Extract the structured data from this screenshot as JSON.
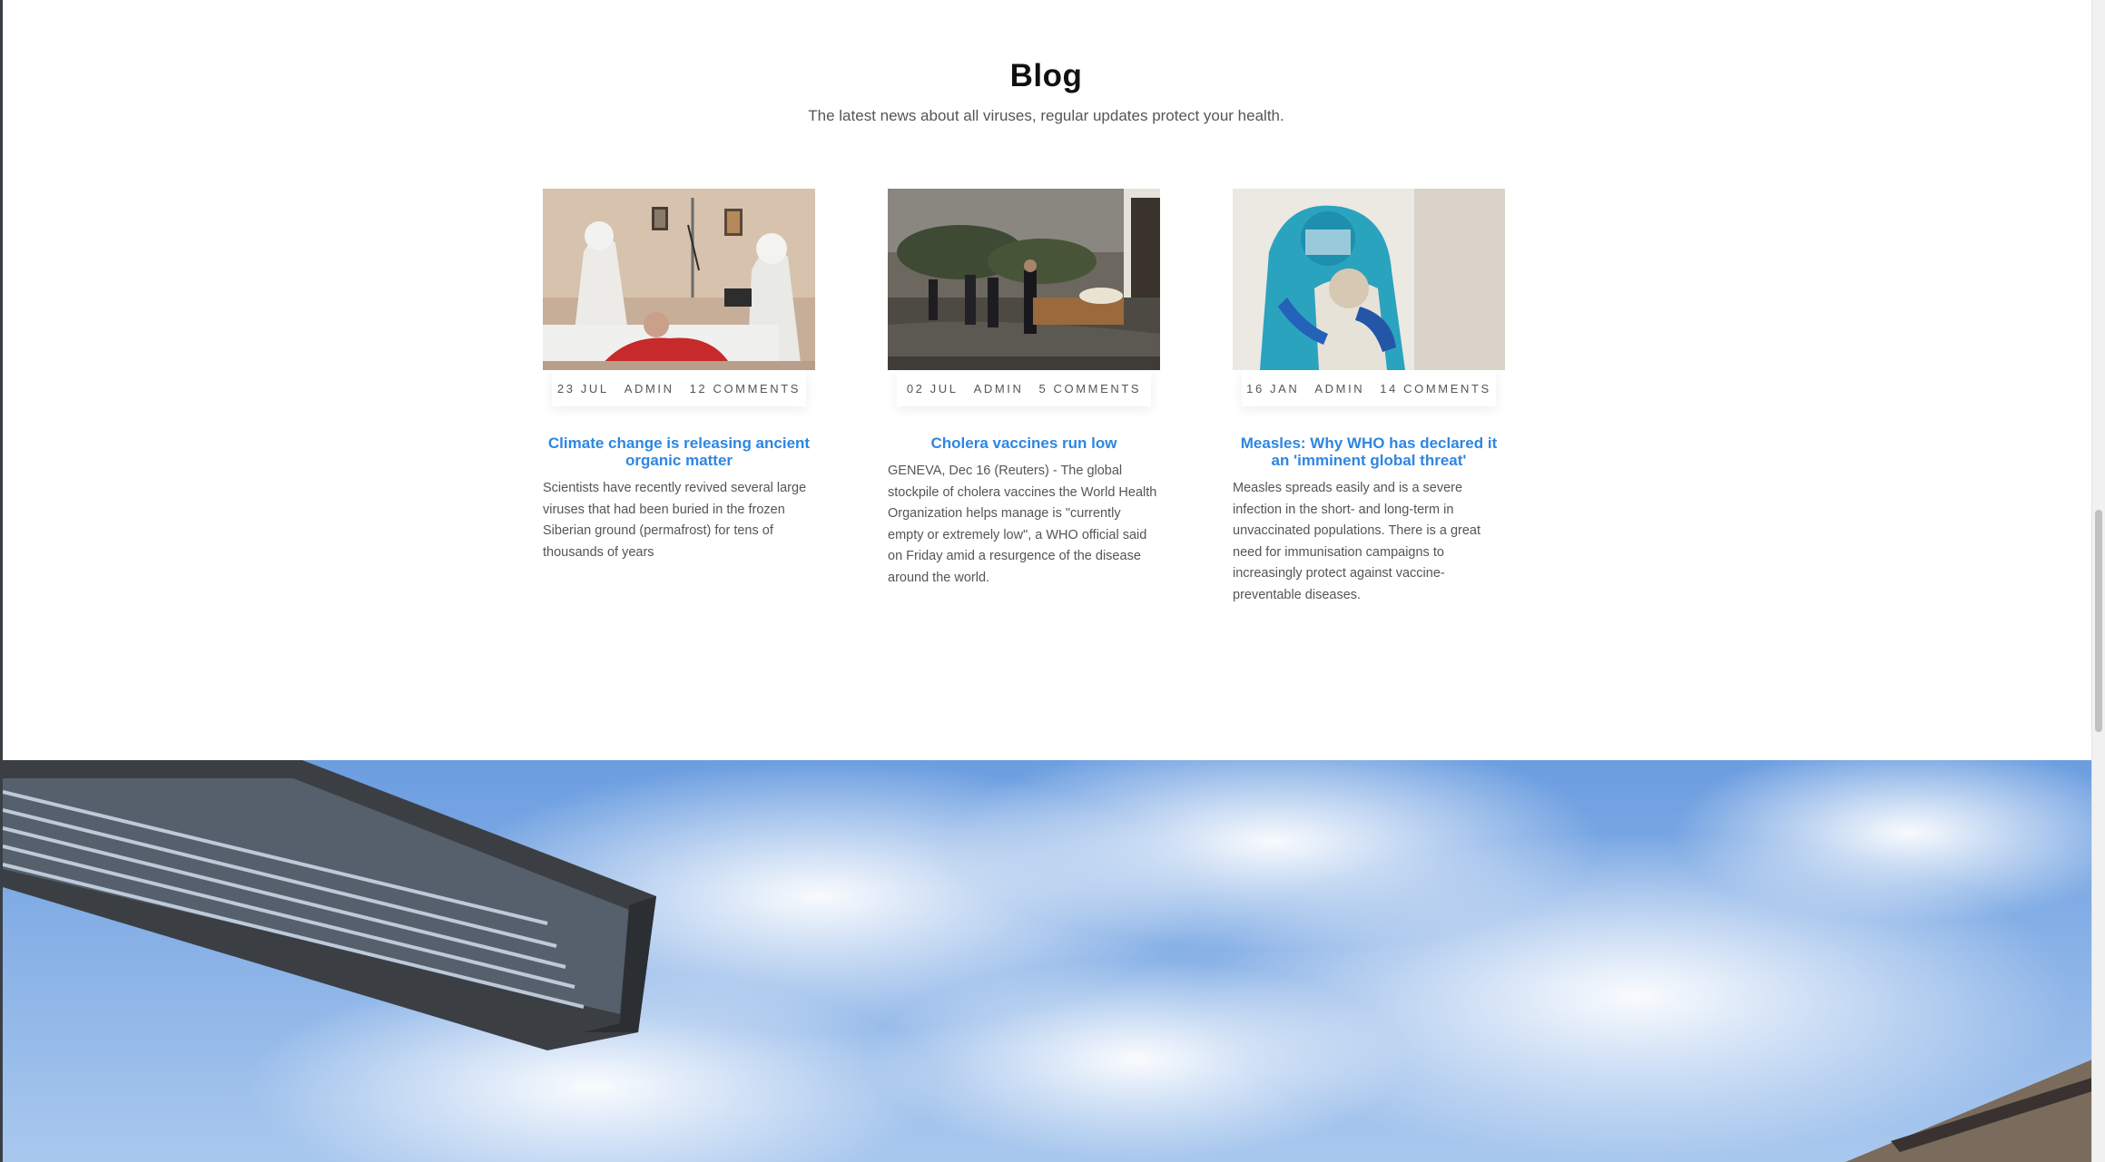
{
  "blog": {
    "title": "Blog",
    "subtitle": "The latest news about all viruses, regular updates protect your health.",
    "posts": [
      {
        "date": "23 JUL",
        "author": "ADMIN",
        "comments": "12 COMMENTS",
        "title": "Climate change is releasing ancient organic matter",
        "excerpt": "Scientists have recently revived several large viruses that had been buried in the frozen Siberian ground (permafrost) for tens of thousands of years"
      },
      {
        "date": "02 JUL",
        "author": "ADMIN",
        "comments": "5 COMMENTS",
        "title": "Cholera vaccines run low",
        "excerpt": "GENEVA, Dec 16 (Reuters) - The global stockpile of cholera vaccines the World Health Organization helps manage is \"currently empty or extremely low\", a WHO official said on Friday amid a resurgence of the disease around the world."
      },
      {
        "date": "16 JAN",
        "author": "ADMIN",
        "comments": "14 COMMENTS",
        "title": "Measles: Why WHO has declared it an 'imminent global threat'",
        "excerpt": "Measles spreads easily and is a severe infection in the short- and long-term in unvaccinated populations. There is a great need for immunisation campaigns to increasingly protect against vaccine-preventable diseases."
      }
    ]
  },
  "colors": {
    "accent": "#2d86e2",
    "title": "#111111",
    "text": "#555555"
  }
}
